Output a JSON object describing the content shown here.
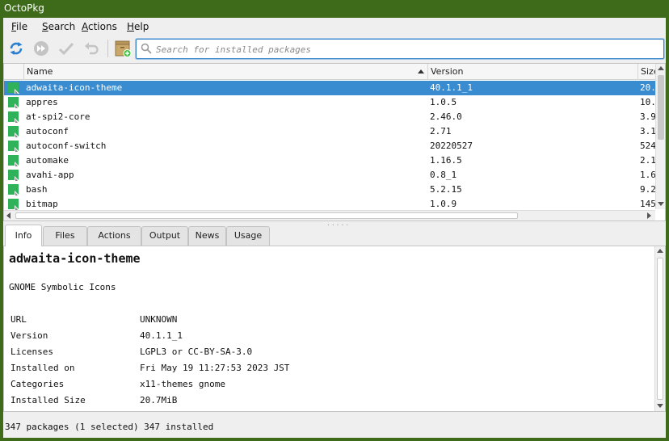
{
  "window": {
    "title": "OctoPkg"
  },
  "menu": [
    "File",
    "Search",
    "Actions",
    "Help"
  ],
  "toolbar": {
    "icons": [
      "sync-icon",
      "commit-icon",
      "check-icon",
      "undo-icon",
      "package-add-icon"
    ],
    "search_placeholder": "Search for installed packages"
  },
  "table": {
    "columns": {
      "name": "Name",
      "version": "Version",
      "size": "Size"
    },
    "rows": [
      {
        "name": "adwaita-icon-theme",
        "version": "40.1.1_1",
        "size": "20.",
        "selected": true
      },
      {
        "name": "appres",
        "version": "1.0.5",
        "size": "10."
      },
      {
        "name": "at-spi2-core",
        "version": "2.46.0",
        "size": "3.9"
      },
      {
        "name": "autoconf",
        "version": "2.71",
        "size": "3.1"
      },
      {
        "name": "autoconf-switch",
        "version": "20220527",
        "size": "524"
      },
      {
        "name": "automake",
        "version": "1.16.5",
        "size": "2.1"
      },
      {
        "name": "avahi-app",
        "version": "0.8_1",
        "size": "1.6"
      },
      {
        "name": "bash",
        "version": "5.2.15",
        "size": "9.2"
      },
      {
        "name": "bitmap",
        "version": "1.0.9",
        "size": "145"
      }
    ]
  },
  "tabs": [
    "Info",
    "Files",
    "Actions",
    "Output",
    "News",
    "Usage"
  ],
  "info": {
    "title": "adwaita-icon-theme",
    "description": "GNOME Symbolic Icons",
    "fields": [
      {
        "key": "URL",
        "value": "UNKNOWN"
      },
      {
        "key": "Version",
        "value": "40.1.1_1"
      },
      {
        "key": "Licenses",
        "value": "LGPL3 or CC-BY-SA-3.0"
      },
      {
        "key": "Installed on",
        "value": "Fri May 19 11:27:53 2023 JST"
      },
      {
        "key": "Categories",
        "value": "x11-themes gnome"
      },
      {
        "key": "Installed Size",
        "value": "20.7MiB"
      }
    ]
  },
  "status": "347 packages (1 selected)  347 installed",
  "colors": {
    "titlebar": "#3d6b1a",
    "selection": "#3a8cd0",
    "package_icon": "#2fb25a"
  }
}
